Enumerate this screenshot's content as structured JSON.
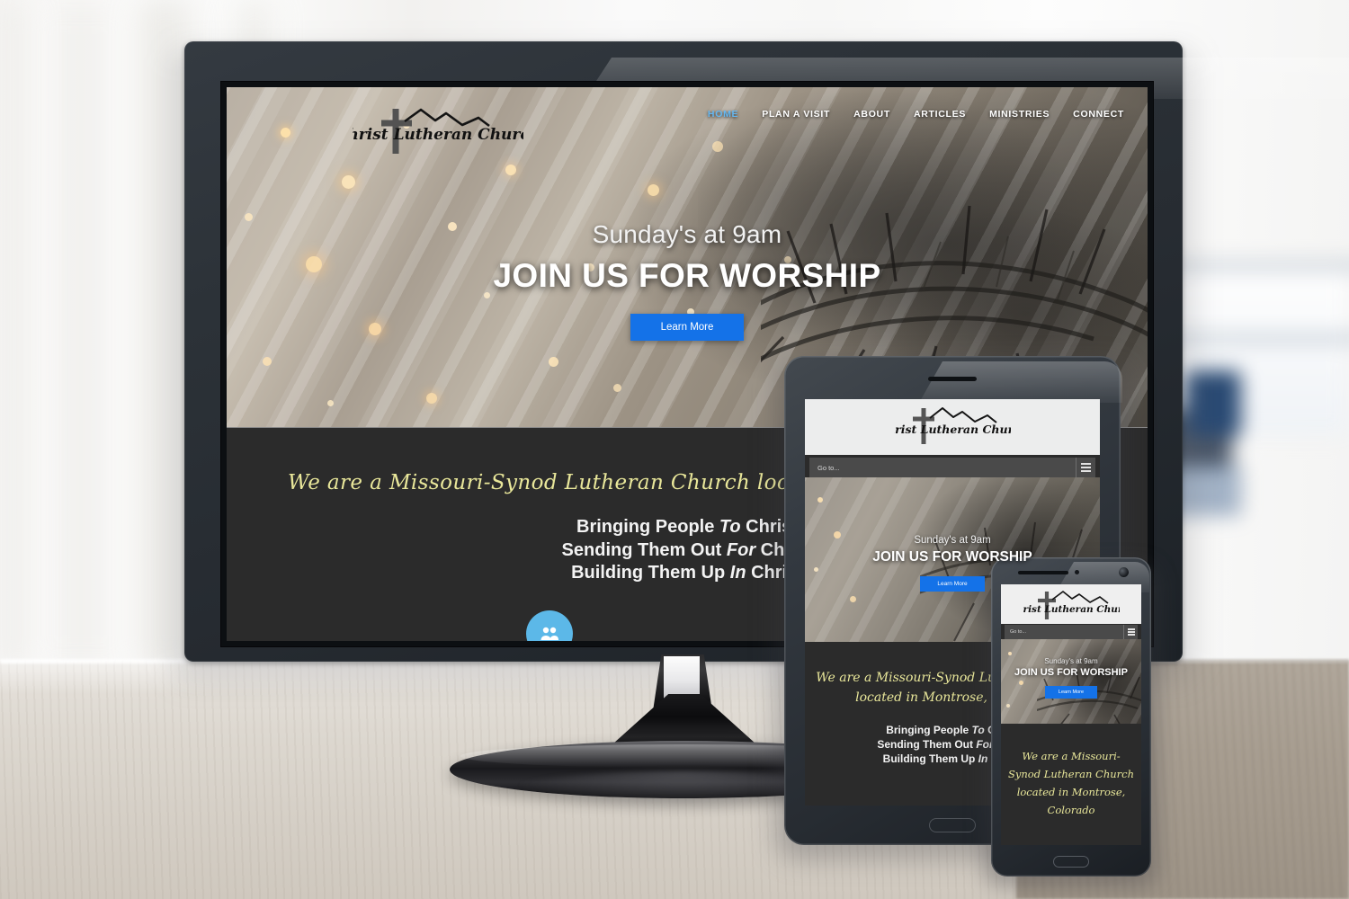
{
  "site": {
    "logo_text": "Christ Lutheran Church",
    "accent_blue": "#1472e8",
    "nav_active_color": "#66b7f0",
    "script_yellow": "#e9e79a",
    "dark_section_bg": "#2b2b2b",
    "circle_icon_color": "#5cb8e8"
  },
  "nav": {
    "items": [
      {
        "label": "HOME",
        "active": true
      },
      {
        "label": "PLAN A VISIT",
        "active": false
      },
      {
        "label": "ABOUT",
        "active": false
      },
      {
        "label": "ARTICLES",
        "active": false
      },
      {
        "label": "MINISTRIES",
        "active": false
      },
      {
        "label": "CONNECT",
        "active": false
      }
    ]
  },
  "hero": {
    "subtitle": "Sunday's at 9am",
    "title": "JOIN US FOR WORSHIP",
    "button_label": "Learn More"
  },
  "intro": {
    "script_text": "We are a Missouri-Synod Lutheran Church located in Montrose, Colorado",
    "script_line_tablet_1": "We are a Missouri-Synod Lutheran Church",
    "script_line_tablet_2": "located in Montrose, Colorado",
    "script_line_phone": "We are a Missouri-Synod Lutheran Church located in Montrose, Colorado"
  },
  "mission": {
    "line1_a": "Bringing People ",
    "line1_em": "To",
    "line1_b": " Christ",
    "line2_a": "Sending Them Out ",
    "line2_em": "For",
    "line2_b": " Christ",
    "line3_a": "Building Them Up ",
    "line3_em": "In",
    "line3_b": " Christ"
  },
  "mobile_nav": {
    "placeholder": "Go to...",
    "menu_icon": "hamburger-icon"
  },
  "devices": {
    "desktop": "desktop-monitor",
    "tablet": "tablet-device",
    "phone": "phone-device"
  }
}
